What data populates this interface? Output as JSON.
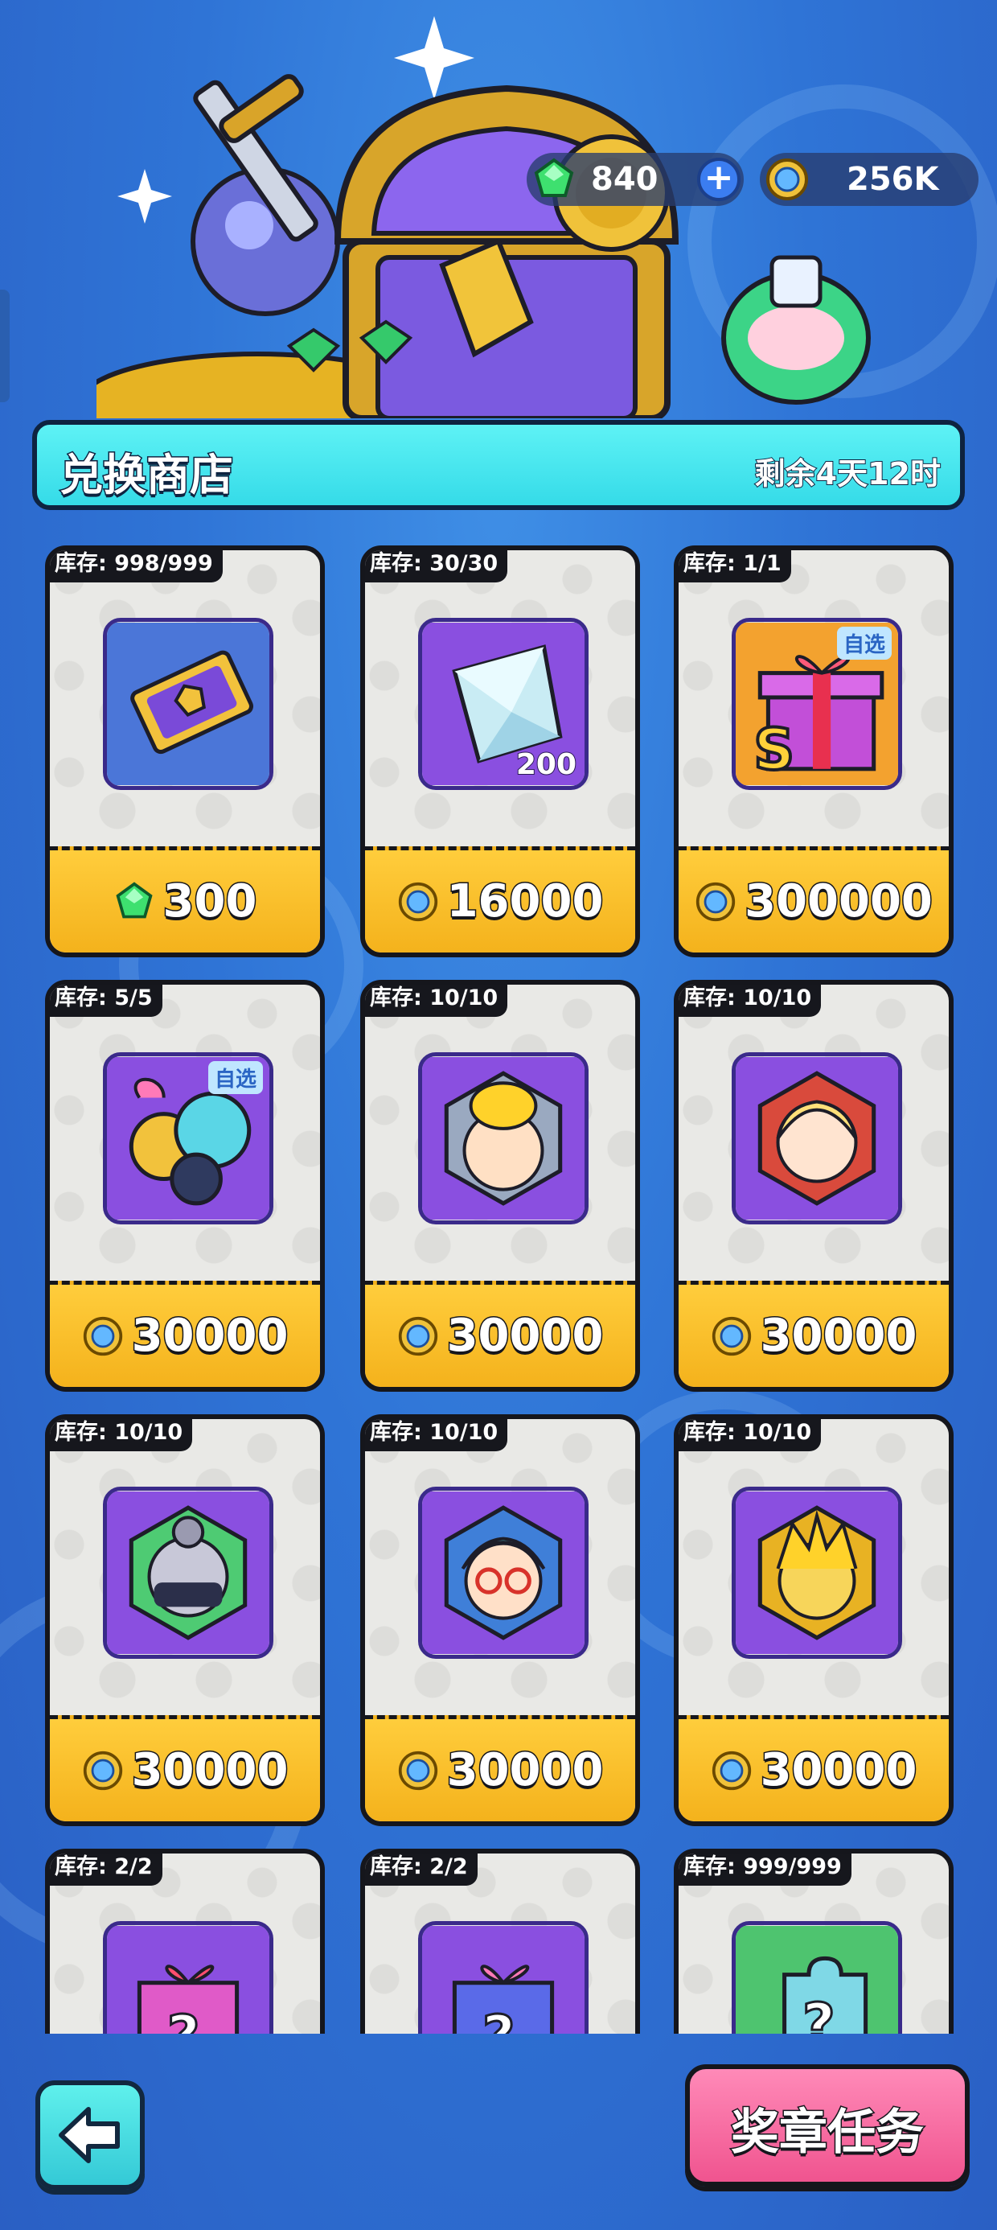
{
  "header": {
    "gems": "840",
    "coins": "256K"
  },
  "shop": {
    "title": "兑换商店",
    "timer": "剩余4天12时"
  },
  "items": [
    {
      "stock": "库存: 998/999",
      "price": "300",
      "currency": "gem-icon",
      "icon": "ticket-icon"
    },
    {
      "stock": "库存: 30/30",
      "price": "16000",
      "currency": "coin-icon",
      "icon": "crystal-icon",
      "qty": "200"
    },
    {
      "stock": "库存: 1/1",
      "price": "300000",
      "currency": "coin-icon",
      "icon": "gift-box-icon",
      "tag": "自选"
    },
    {
      "stock": "库存: 5/5",
      "price": "30000",
      "currency": "coin-icon",
      "icon": "hero-bundle-icon",
      "tag": "自选"
    },
    {
      "stock": "库存: 10/10",
      "price": "30000",
      "currency": "coin-icon",
      "icon": "hero-blonde-boy-icon"
    },
    {
      "stock": "库存: 10/10",
      "price": "30000",
      "currency": "coin-icon",
      "icon": "hero-blonde-girl-icon"
    },
    {
      "stock": "库存: 10/10",
      "price": "30000",
      "currency": "coin-icon",
      "icon": "hero-ninja-icon"
    },
    {
      "stock": "库存: 10/10",
      "price": "30000",
      "currency": "coin-icon",
      "icon": "hero-glasses-icon"
    },
    {
      "stock": "库存: 10/10",
      "price": "30000",
      "currency": "coin-icon",
      "icon": "hero-golden-icon"
    },
    {
      "stock": "库存: 2/2",
      "price": "",
      "currency": "coin-icon",
      "icon": "mystery-box-pink-icon"
    },
    {
      "stock": "库存: 2/2",
      "price": "",
      "currency": "coin-icon",
      "icon": "mystery-box-blue-icon"
    },
    {
      "stock": "库存: 999/999",
      "price": "",
      "currency": "coin-icon",
      "icon": "mystery-puzzle-icon"
    }
  ],
  "footer": {
    "medal_button": "奖章任务"
  },
  "colors": {
    "title_bar": "#35dbe8",
    "price_bar": "#f4b21c",
    "medal_button": "#f0548f",
    "back_button": "#34c9d6"
  }
}
